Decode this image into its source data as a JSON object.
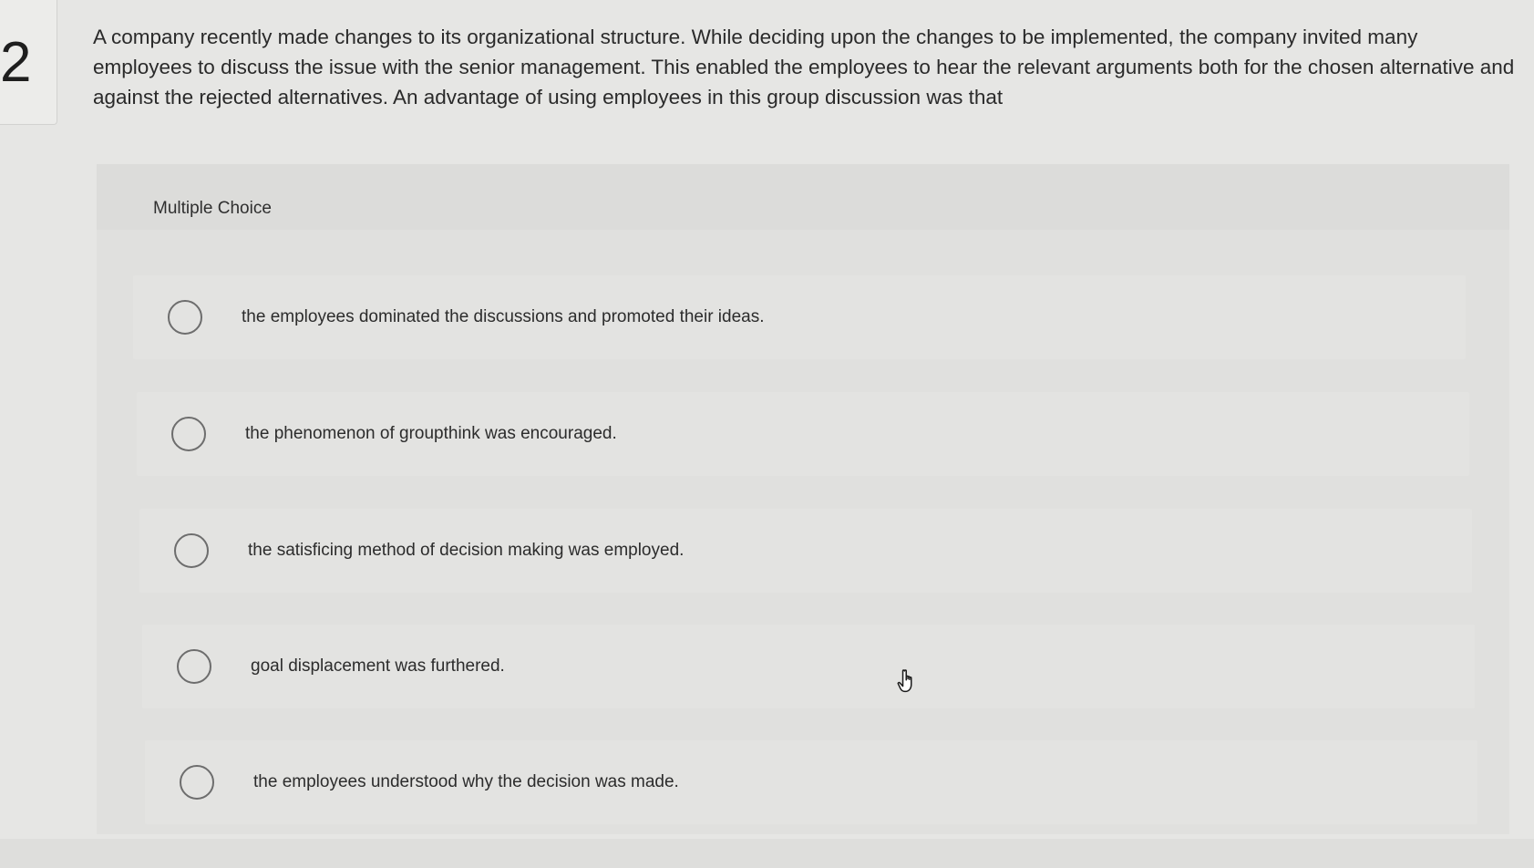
{
  "question": {
    "number": "2",
    "text": "A company recently made changes to its organizational structure. While deciding upon the changes to be implemented, the company invited many employees to discuss the issue with the senior management. This enabled the employees to hear the relevant arguments both for the chosen alternative and against the rejected alternatives. An advantage of using employees in this group discussion was that"
  },
  "choices": {
    "heading": "Multiple Choice",
    "options": [
      {
        "label": "the employees dominated the discussions and promoted their ideas.",
        "selected": false
      },
      {
        "label": "the phenomenon of groupthink was encouraged.",
        "selected": false
      },
      {
        "label": "the satisficing method of decision making was employed.",
        "selected": false
      },
      {
        "label": "goal displacement was furthered.",
        "selected": false
      },
      {
        "label": "the employees understood why the decision was made.",
        "selected": false
      }
    ]
  },
  "colors": {
    "background": "#e6e6e4",
    "panel": "#e0e0de",
    "radio_border": "#6d6d6d",
    "text": "#2b2b2b"
  },
  "icons": {
    "cursor": "hand-pointer-icon"
  }
}
